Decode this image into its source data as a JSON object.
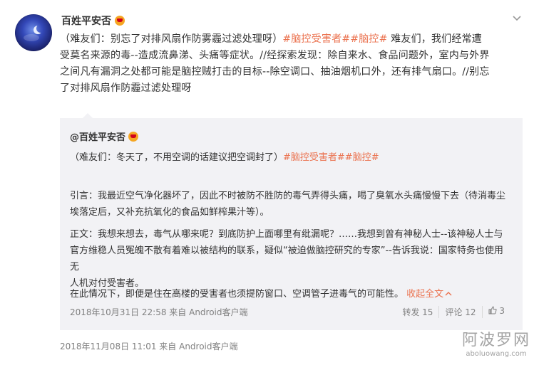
{
  "post": {
    "author": "百姓平安否",
    "text_line1_a": "（难友们：别忘了对排风扇作防雾霾过滤处理呀）",
    "text_line1_tags": "#脑控受害者##脑控#",
    "text_line1_b": " 难友们，我们经常遭",
    "text_line2": "受莫名来源的毒--造成流鼻涕、头痛等症状。//经探索发现：除自来水、食品问题外，室内与外界",
    "text_line3": "之间凡有漏洞之处都可能是脑控贼打击的目标--除空调口、抽油烟机口外，还有排气扇口。//别忘",
    "text_line4": "了对排风扇作防霾过滤处理呀",
    "timestamp": "2018年11月08日 11:01 来自 Android客户端"
  },
  "repost": {
    "author": "@百姓平安否",
    "line1_a": "（难友们：冬天了，不用空调的话建议把空调封了）",
    "line1_tags": "#脑控受害者##脑控#",
    "para1_line1": "引言：我最近空气净化器坏了，因此不时被防不胜防的毒气弄得头痛，喝了臭氧水头痛慢慢下去（待消毒尘",
    "para1_line2": "埃落定后，又补充抗氧化的食品如鲜榨果汁等）。",
    "para2_line1": "正文：我想来想去，毒气从哪来呢？到底防护上面哪里有纰漏呢？……我想到曾有神秘人士--该神秘人士与",
    "para2_line2": "官方维稳人员冤魄不散有着难以被结构的联系，疑似“被迫做脑控研究的专家”--告诉我说：国家特务也使用无",
    "para2_line3": "人机对付受害者。",
    "para3": "在此情况下，即便是住在高楼的受害者也须提防窗口、空调管子进毒气的可能性。",
    "collapse_label": "收起全文",
    "timestamp": "2018年10月31日 22:58 来自 Android客户端",
    "repost_label": "转发 15",
    "comment_label": "评论 12",
    "like_count": "3"
  },
  "watermark": {
    "cn": "阿波罗网",
    "url": "aboluowang.com"
  },
  "colors": {
    "accent": "#eb7350",
    "repost_bg": "#f2f2f5",
    "muted": "#808080"
  },
  "icons": [
    "avatar-moon",
    "crown-badge-icon",
    "chevron-down-icon",
    "chevron-up-icon",
    "thumbs-up-icon"
  ]
}
